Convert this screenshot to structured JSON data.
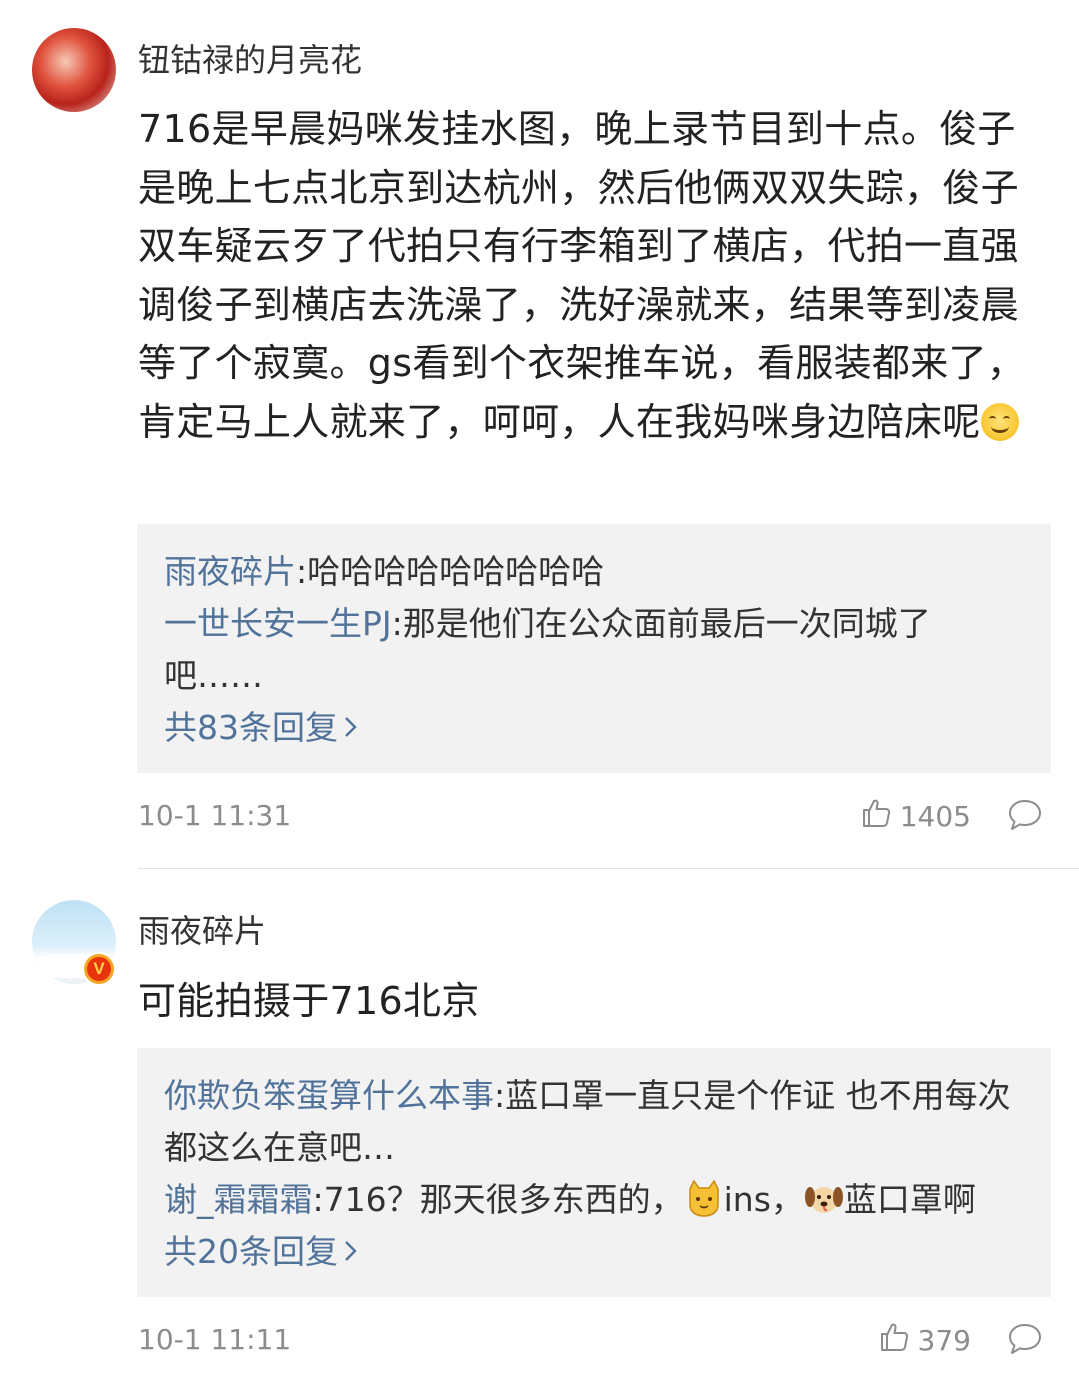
{
  "comments": [
    {
      "username": "钮钴禄的月亮花",
      "content": "716是早晨妈咪发挂水图，晚上录节目到十点。俊子是晚上七点北京到达杭州，然后他俩双双失踪，俊子双车疑云歹了代拍只有行李箱到了横店，代拍一直强调俊子到横店去洗澡了，洗好澡就来，结果等到凌晨等了个寂寞。gs看到个衣架推车说，看服装都来了，肯定马上人就来了，呵呵，人在我妈咪身边陪床呢",
      "replies": [
        {
          "user": "雨夜碎片",
          "text": ":哈哈哈哈哈哈哈哈哈"
        },
        {
          "user": "一世长安一生PJ",
          "text": ":那是他们在公众面前最后一次同城了吧……"
        }
      ],
      "reply_total": "共83条回复",
      "timestamp": "10-1 11:31",
      "likes": "1405"
    },
    {
      "username": "雨夜碎片",
      "content": "可能拍摄于716北京",
      "replies": [
        {
          "user": "你欺负笨蛋算什么本事",
          "text": ":蓝口罩一直只是个作证 也不用每次都这么在意吧…"
        },
        {
          "user": "谢_霜霜霜",
          "text_a": ":716？那天很多东西的，",
          "text_b": "ins，",
          "text_c": "蓝口罩啊"
        }
      ],
      "reply_total": "共20条回复",
      "timestamp": "10-1 11:11",
      "likes": "379"
    }
  ],
  "icons": [
    "thumbs-up-icon",
    "comment-bubble-icon",
    "chevron-right-icon",
    "smile-emoji",
    "cat-emoji",
    "dog-emoji",
    "verified-badge-icon"
  ],
  "colors": {
    "link": "#51739a",
    "meta": "#8c8c8c",
    "reply_bg": "#f2f2f2",
    "badge": "#f5a623"
  }
}
